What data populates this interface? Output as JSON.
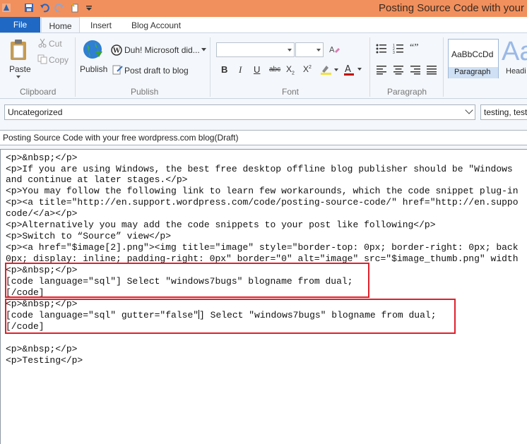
{
  "window": {
    "title": "Posting Source Code with your free"
  },
  "tabs": {
    "file": "File",
    "home": "Home",
    "insert": "Insert",
    "blog_account": "Blog Account"
  },
  "clipboard": {
    "paste": "Paste",
    "cut": "Cut",
    "copy": "Copy",
    "label": "Clipboard"
  },
  "publish_group": {
    "publish": "Publish",
    "blog_selector": "Duh! Microsoft did...",
    "post_draft": "Post draft to blog",
    "label": "Publish"
  },
  "font_group": {
    "label": "Font"
  },
  "paragraph_group": {
    "label": "Paragraph"
  },
  "styles": {
    "paragraph_preview": "AaBbCcDd",
    "paragraph_label": "Paragraph",
    "heading_preview": "Aa",
    "heading_label": "Headi"
  },
  "category": {
    "value": "Uncategorized"
  },
  "tags": {
    "value": "testing, test"
  },
  "document": {
    "title": "Posting Source Code with your free wordpress.com blog(Draft)"
  },
  "source": {
    "lines": [
      "<p>&nbsp;</p>",
      "<p>If you are using Windows, the best free desktop offline blog publisher should be \"Windows",
      "and continue at later stages.</p>",
      "<p>You may follow the following link to learn few workarounds, which the code snippet plug-in",
      "<p><a title=\"http://en.support.wordpress.com/code/posting-source-code/\" href=\"http://en.suppo",
      "code/</a></p>",
      "<p>Alternatively you may add the code snippets to your post like following</p>",
      "<p>Switch to “Source” view</p>",
      "<p><a href=\"$image[2].png\"><img title=\"image\" style=\"border-top: 0px; border-right: 0px; back",
      "0px; display: inline; padding-right: 0px\" border=\"0\" alt=\"image\" src=\"$image_thumb.png\" width",
      "<p>&nbsp;</p>",
      "[code language=\"sql\"] Select \"windows7bugs\" blogname from dual;",
      "[/code]",
      "<p>&nbsp;</p>",
      "[code language=\"sql\" gutter=\"false\"",
      "] Select \"windows7bugs\" blogname from dual;",
      "[/code]",
      "",
      "<p>&nbsp;</p>",
      "<p>Testing</p>"
    ]
  },
  "colors": {
    "titlebar": "#f1905d",
    "file_tab": "#1f69c4",
    "highlight_box": "#e0202a"
  }
}
